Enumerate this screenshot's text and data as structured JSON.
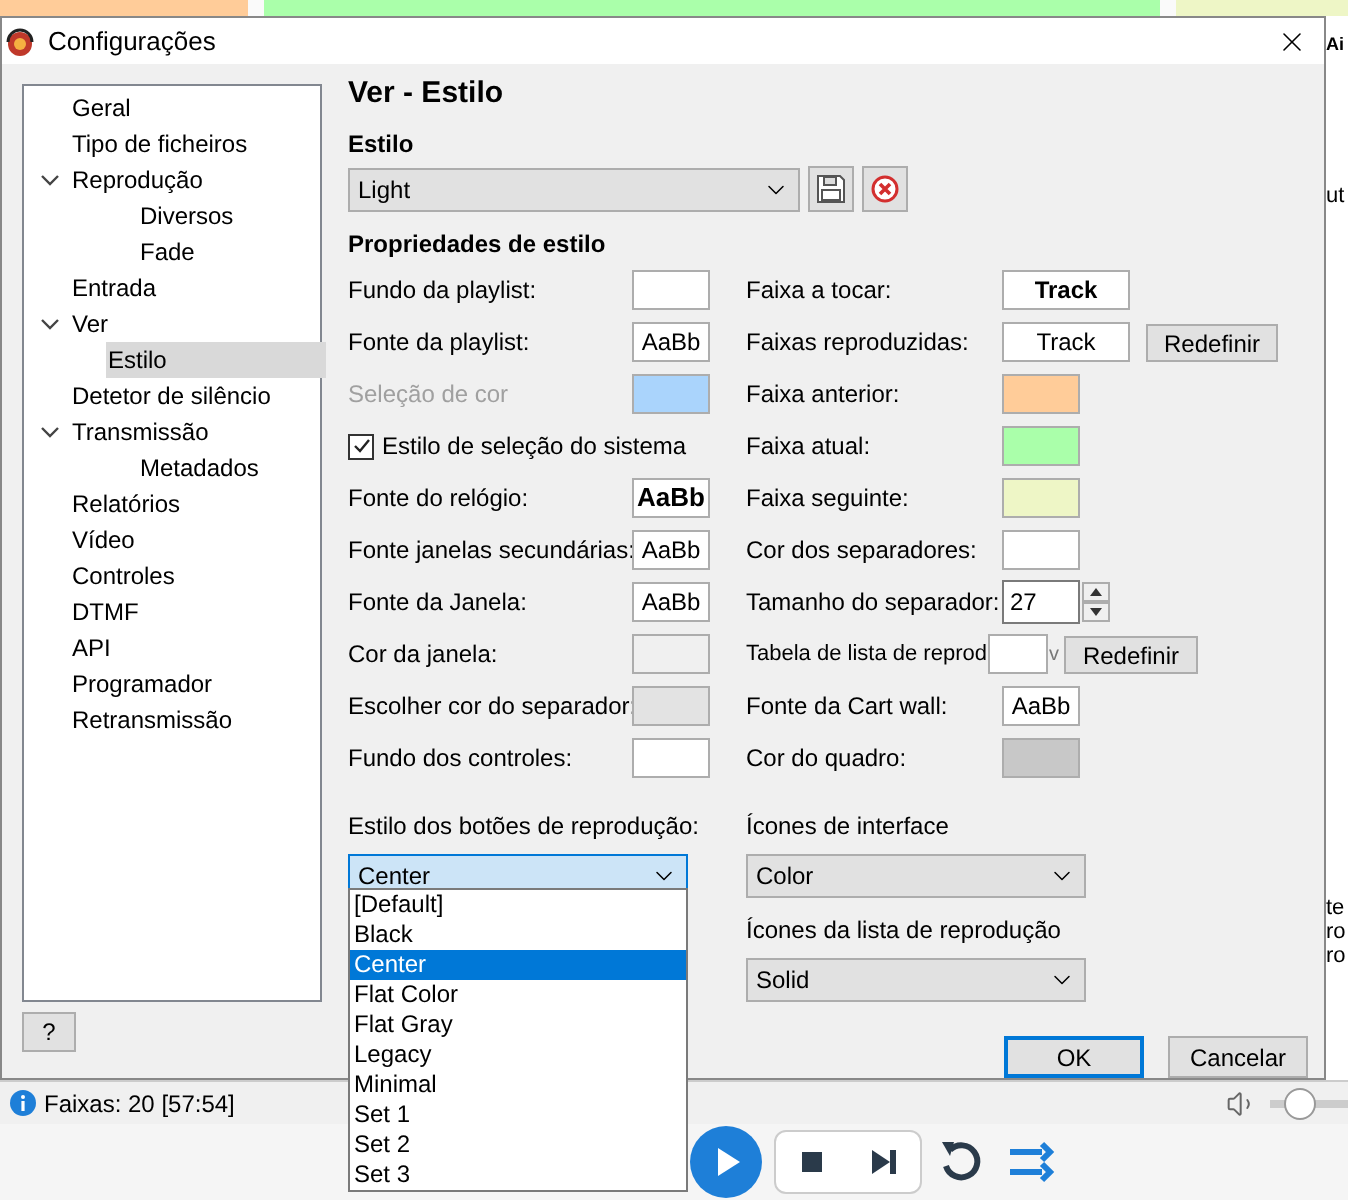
{
  "window": {
    "title": "Configurações"
  },
  "sidebar": {
    "items": [
      {
        "label": "Geral",
        "selected": false
      },
      {
        "label": "Tipo de ficheiros",
        "selected": false
      },
      {
        "label": "Reprodução",
        "selected": false,
        "expanded": true,
        "children": [
          {
            "label": "Diversos",
            "selected": false
          },
          {
            "label": "Fade",
            "selected": false
          }
        ]
      },
      {
        "label": "Entrada",
        "selected": false
      },
      {
        "label": "Ver",
        "selected": false,
        "expanded": true,
        "children": [
          {
            "label": "Estilo",
            "selected": true
          }
        ]
      },
      {
        "label": "Detetor de silêncio",
        "selected": false
      },
      {
        "label": "Transmissão",
        "selected": false,
        "expanded": true,
        "children": [
          {
            "label": "Metadados",
            "selected": false
          }
        ]
      },
      {
        "label": "Relatórios",
        "selected": false
      },
      {
        "label": "Vídeo",
        "selected": false
      },
      {
        "label": "Controles",
        "selected": false
      },
      {
        "label": "DTMF",
        "selected": false
      },
      {
        "label": "API",
        "selected": false
      },
      {
        "label": "Programador",
        "selected": false
      },
      {
        "label": "Retransmissão",
        "selected": false
      }
    ]
  },
  "help_button": "?",
  "page_title": "Ver - Estilo",
  "style": {
    "label": "Estilo",
    "value": "Light"
  },
  "properties": {
    "title": "Propriedades de estilo",
    "left": [
      {
        "kind": "color",
        "label": "Fundo da playlist:",
        "color": "#ffffff",
        "disabled": false
      },
      {
        "kind": "font",
        "label": "Fonte da playlist:",
        "sample": "AaBb",
        "bold": false,
        "disabled": false
      },
      {
        "kind": "color",
        "label": "Seleção de cor",
        "color": "#aad4fc",
        "disabled": true
      },
      {
        "kind": "checkbox",
        "label": "Estilo de seleção do sistema",
        "checked": true,
        "disabled": false
      },
      {
        "kind": "font",
        "label": "Fonte do relógio:",
        "sample": "AaBb",
        "bold": true,
        "disabled": false
      },
      {
        "kind": "font",
        "label": "Fonte janelas secundárias:",
        "sample": "AaBb",
        "bold": false,
        "disabled": false
      },
      {
        "kind": "font",
        "label": "Fonte da Janela:",
        "sample": "AaBb",
        "bold": false,
        "disabled": false
      },
      {
        "kind": "color",
        "label": "Cor da janela:",
        "color": "#f0f0f0",
        "disabled": false
      },
      {
        "kind": "color",
        "label": "Escolher cor do separador:",
        "color": "#e3e3e3",
        "disabled": false
      },
      {
        "kind": "color",
        "label": "Fundo dos controles:",
        "color": "#ffffff",
        "disabled": false
      }
    ],
    "right": [
      {
        "kind": "track",
        "label": "Faixa a tocar:",
        "sample": "Track",
        "bold": true
      },
      {
        "kind": "track",
        "label": "Faixas reproduzidas:",
        "sample": "Track",
        "bold": false,
        "button": "Redefinir"
      },
      {
        "kind": "color",
        "label": "Faixa anterior:",
        "color": "#ffcc99"
      },
      {
        "kind": "color",
        "label": "Faixa atual:",
        "color": "#aaffaa"
      },
      {
        "kind": "color",
        "label": "Faixa seguinte:",
        "color": "#eef6c6"
      },
      {
        "kind": "color",
        "label": "Cor dos separadores:",
        "color": "#ffffff"
      },
      {
        "kind": "spin",
        "label": "Tamanho do separador:",
        "value": "27"
      },
      {
        "kind": "table",
        "label": "Tabela de lista de reprod",
        "fragment": "v",
        "button": "Redefinir"
      },
      {
        "kind": "font",
        "label": "Fonte da Cart wall:",
        "sample": "AaBb",
        "bold": false
      },
      {
        "kind": "color",
        "label": "Cor do quadro:",
        "color": "#c8c8c8"
      }
    ]
  },
  "playback_buttons_style": {
    "label": "Estilo dos botões de reprodução:",
    "value": "Center",
    "open": true,
    "options": [
      {
        "label": "[Default]",
        "selected": false
      },
      {
        "label": "Black",
        "selected": false
      },
      {
        "label": "Center",
        "selected": true
      },
      {
        "label": "Flat Color",
        "selected": false
      },
      {
        "label": "Flat Gray",
        "selected": false
      },
      {
        "label": "Legacy",
        "selected": false
      },
      {
        "label": "Minimal",
        "selected": false
      },
      {
        "label": "Set 1",
        "selected": false
      },
      {
        "label": "Set 2",
        "selected": false
      },
      {
        "label": "Set 3",
        "selected": false
      }
    ]
  },
  "interface_icons": {
    "label": "Ícones de interface",
    "value": "Color"
  },
  "playlist_icons": {
    "label": "Ícones da lista de reprodução",
    "value": "Solid"
  },
  "buttons": [
    {
      "label": "OK",
      "default": true
    },
    {
      "label": "Cancelar",
      "default": false
    }
  ],
  "background_fragments": [
    "Ai",
    "ut",
    "te",
    "ro",
    "ro"
  ],
  "status_bar": {
    "text": "Faixas: 20 [57:54]",
    "volume": {
      "level": 0.35
    }
  }
}
